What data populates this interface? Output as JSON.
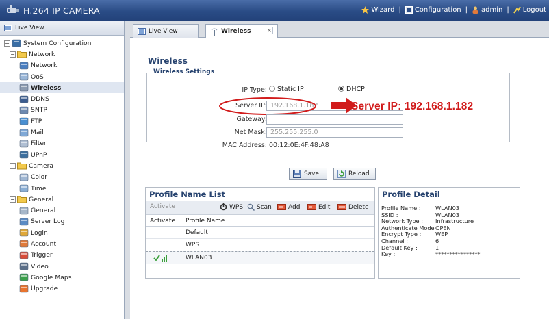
{
  "app": {
    "title": "H.264 IP CAMERA"
  },
  "topnav": {
    "wizard": "Wizard",
    "configuration": "Configuration",
    "user": "admin",
    "logout": "Logout",
    "separator": "|"
  },
  "left": {
    "header": "Live View",
    "tree": [
      {
        "label": "System Configuration",
        "level": 0,
        "icon": "settings-icon",
        "expander": "−"
      },
      {
        "label": "Network",
        "level": 1,
        "icon": "folder-icon",
        "expander": "−"
      },
      {
        "label": "Network",
        "level": 2,
        "icon": "network-icon"
      },
      {
        "label": "QoS",
        "level": 2,
        "icon": "qos-icon"
      },
      {
        "label": "Wireless",
        "level": 2,
        "icon": "wireless-icon",
        "selected": true
      },
      {
        "label": "DDNS",
        "level": 2,
        "icon": "ddns-icon"
      },
      {
        "label": "SNTP",
        "level": 2,
        "icon": "sntp-icon"
      },
      {
        "label": "FTP",
        "level": 2,
        "icon": "ftp-icon"
      },
      {
        "label": "Mail",
        "level": 2,
        "icon": "mail-icon"
      },
      {
        "label": "Filter",
        "level": 2,
        "icon": "filter-icon"
      },
      {
        "label": "UPnP",
        "level": 2,
        "icon": "upnp-icon"
      },
      {
        "label": "Camera",
        "level": 1,
        "icon": "folder-icon",
        "expander": "−"
      },
      {
        "label": "Color",
        "level": 2,
        "icon": "color-icon"
      },
      {
        "label": "Time",
        "level": 2,
        "icon": "time-icon"
      },
      {
        "label": "General",
        "level": 1,
        "icon": "folder-icon",
        "expander": "−"
      },
      {
        "label": "General",
        "level": 2,
        "icon": "general-icon"
      },
      {
        "label": "Server Log",
        "level": 2,
        "icon": "server-log-icon"
      },
      {
        "label": "Login",
        "level": 2,
        "icon": "login-icon"
      },
      {
        "label": "Account",
        "level": 2,
        "icon": "account-icon"
      },
      {
        "label": "Trigger",
        "level": 2,
        "icon": "trigger-icon"
      },
      {
        "label": "Video",
        "level": 2,
        "icon": "video-icon"
      },
      {
        "label": "Google Maps",
        "level": 2,
        "icon": "google-maps-icon"
      },
      {
        "label": "Upgrade",
        "level": 2,
        "icon": "upgrade-icon"
      }
    ]
  },
  "tabs": [
    {
      "label": "Live View"
    },
    {
      "label": "Wireless",
      "active": true,
      "close": "×"
    }
  ],
  "wireless": {
    "title": "Wireless",
    "settings_legend": "Wireless Settings",
    "ip_type_label": "IP Type:",
    "static_ip": "Static IP",
    "dhcp": "DHCP",
    "ip_type_selected": "DHCP",
    "server_ip_label": "Server IP:",
    "server_ip_value": "192.168.1.182",
    "gateway_label": "Gateway:",
    "gateway_value": "",
    "netmask_label": "Net Mask:",
    "netmask_value": "255.255.255.0",
    "mac_label": "MAC Address:",
    "mac_value": "00:12:0E:4F:48:A8",
    "annotation": "Server IP: 192.168.1.182",
    "save": "Save",
    "reload": "Reload"
  },
  "profile_list": {
    "title": "Profile Name List",
    "toolbar": {
      "activate": "Activate",
      "wps": "WPS",
      "scan": "Scan",
      "add": "Add",
      "edit": "Edit",
      "delete": "Delete"
    },
    "columns": {
      "activate": "Activate",
      "name": "Profile Name"
    },
    "rows": [
      {
        "name": "Default"
      },
      {
        "name": "WPS"
      },
      {
        "name": "WLAN03",
        "active": true
      }
    ]
  },
  "profile_detail": {
    "title": "Profile Detail",
    "rows": [
      {
        "key": "Profile Name :",
        "value": "WLAN03"
      },
      {
        "key": "SSID :",
        "value": "WLAN03"
      },
      {
        "key": "Network Type :",
        "value": "Infrastructure"
      },
      {
        "key": "Authenticate Mode :",
        "value": "OPEN"
      },
      {
        "key": "Encrypt Type :",
        "value": "WEP"
      },
      {
        "key": "Channel :",
        "value": "6"
      },
      {
        "key": "Default Key :",
        "value": "1"
      },
      {
        "key": "Key :",
        "value": "****************"
      }
    ]
  },
  "colors": {
    "header_blue": "#2a4c86",
    "accent_red": "#d11b1b",
    "title_blue": "#27436f"
  }
}
